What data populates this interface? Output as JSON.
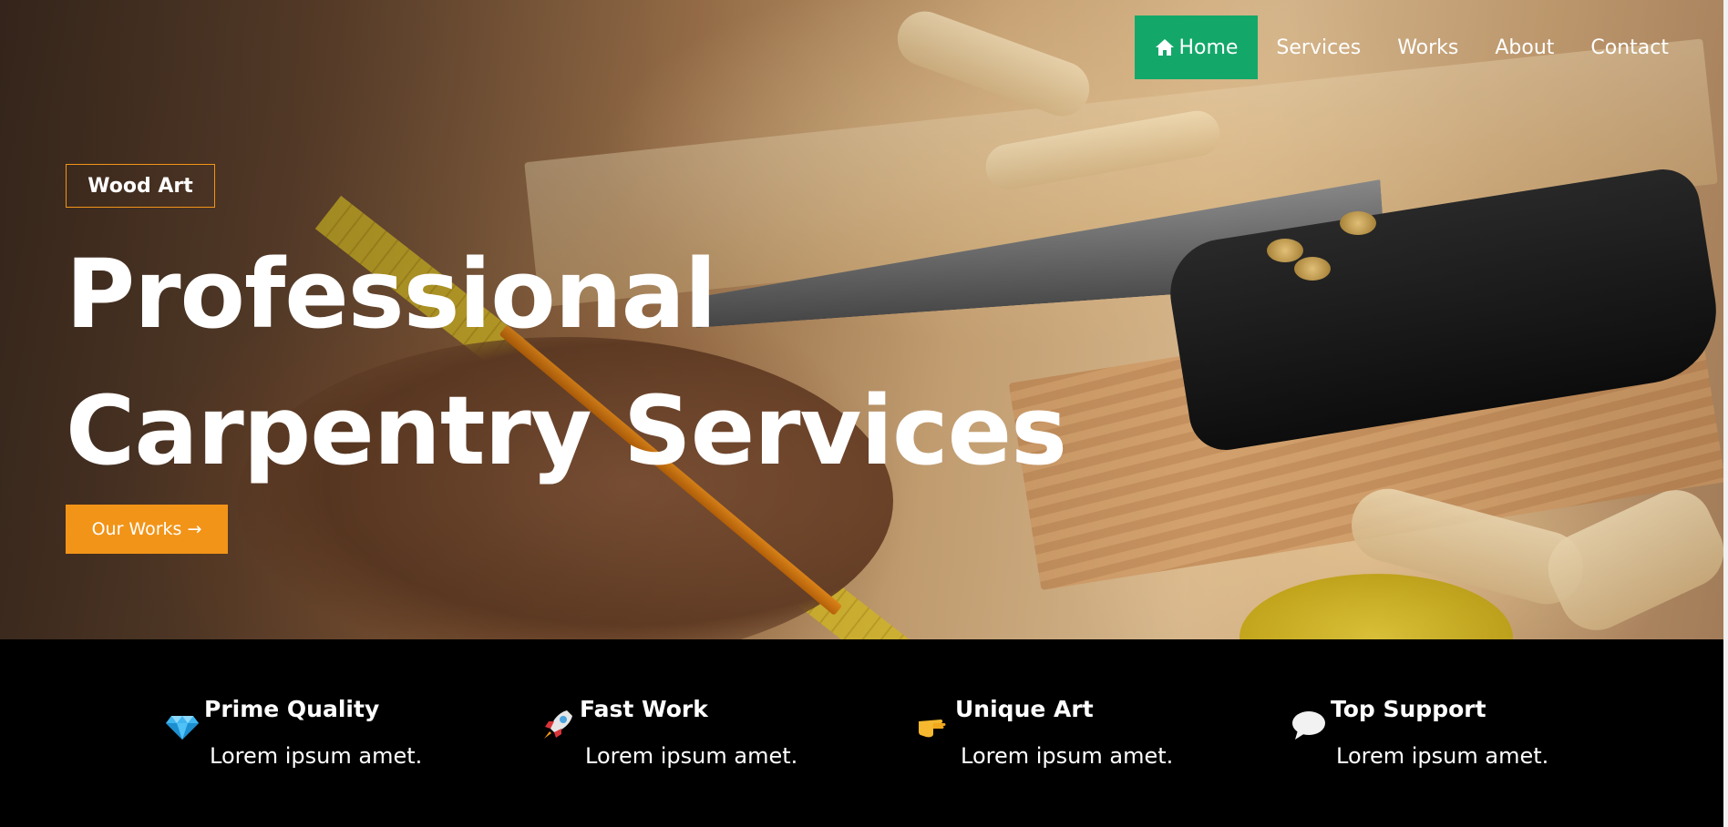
{
  "nav": {
    "items": [
      {
        "label": "Home",
        "icon": "home-icon",
        "active": true
      },
      {
        "label": "Services",
        "active": false
      },
      {
        "label": "Works",
        "active": false
      },
      {
        "label": "About",
        "active": false
      },
      {
        "label": "Contact",
        "active": false
      }
    ]
  },
  "hero": {
    "badge": "Wood Art",
    "title_line1": "Professional",
    "title_line2": "Carpentry Services",
    "cta_label": "Our Works →"
  },
  "features": [
    {
      "icon": "diamond-icon",
      "title": "Prime Quality",
      "text": "Lorem ipsum amet."
    },
    {
      "icon": "rocket-icon",
      "title": "Fast Work",
      "text": "Lorem ipsum amet."
    },
    {
      "icon": "pointing-hand-icon",
      "title": "Unique Art",
      "text": "Lorem ipsum amet."
    },
    {
      "icon": "speech-bubble-icon",
      "title": "Top Support",
      "text": "Lorem ipsum amet."
    }
  ],
  "colors": {
    "nav_active": "#13a86a",
    "accent": "#f29418",
    "strip_bg": "#000000",
    "text": "#ffffff"
  }
}
